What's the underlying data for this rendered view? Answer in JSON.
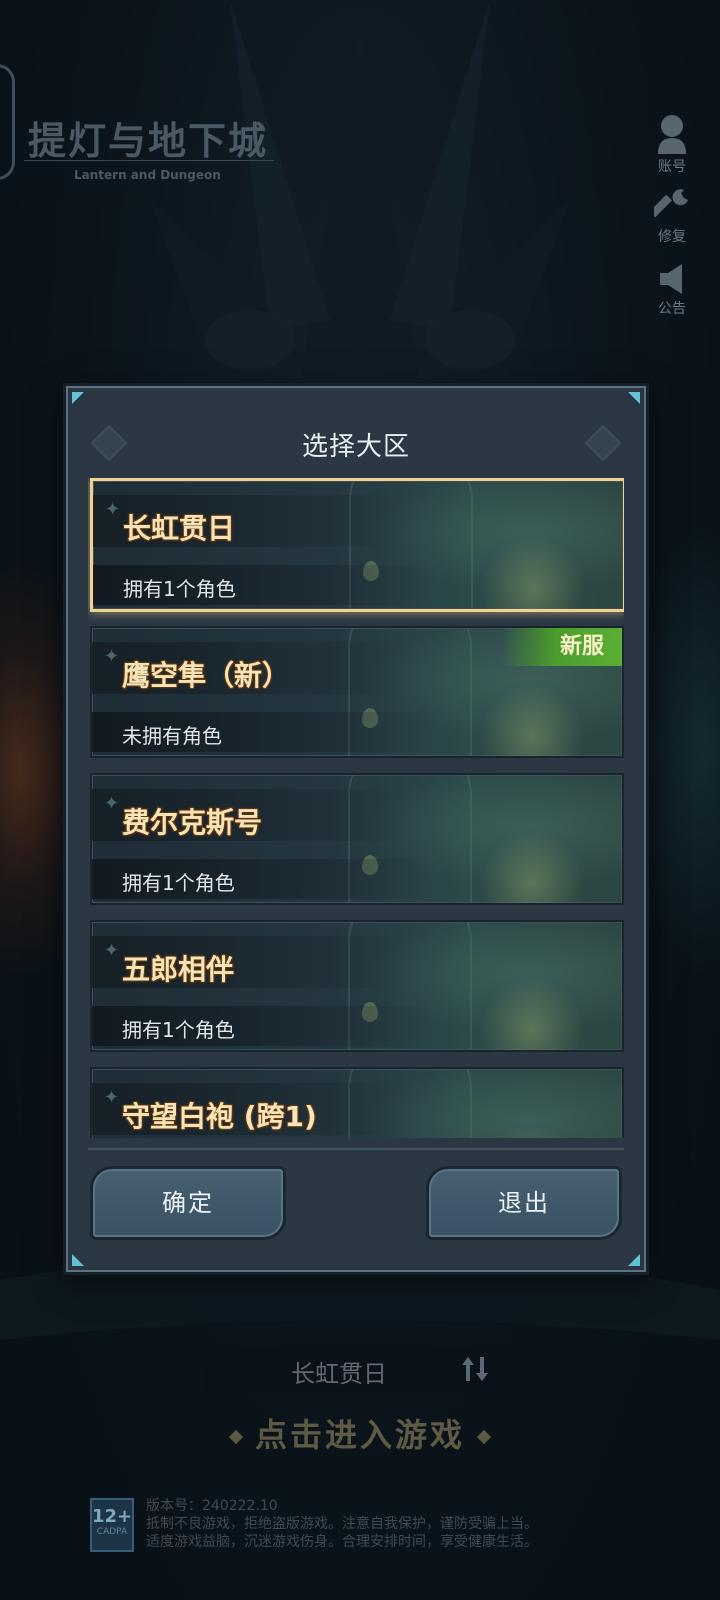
{
  "game": {
    "title": "提灯与地下城",
    "subtitle": "Lantern and Dungeon"
  },
  "side_menu": [
    {
      "label": "账号",
      "icon": "account-icon"
    },
    {
      "label": "修复",
      "icon": "wrench-icon"
    },
    {
      "label": "公告",
      "icon": "speaker-icon"
    }
  ],
  "dialog": {
    "title": "选择大区",
    "servers": [
      {
        "name": "长虹贯日",
        "status": "拥有1个角色",
        "selected": true,
        "badge": ""
      },
      {
        "name": "鹰空隼（新）",
        "status": "未拥有角色",
        "selected": false,
        "badge": "新服"
      },
      {
        "name": "费尔克斯号",
        "status": "拥有1个角色",
        "selected": false,
        "badge": ""
      },
      {
        "name": "五郎相伴",
        "status": "拥有1个角色",
        "selected": false,
        "badge": ""
      },
      {
        "name": "守望白袍 (跨1)",
        "status": "",
        "selected": false,
        "badge": ""
      }
    ],
    "confirm_label": "确定",
    "exit_label": "退出"
  },
  "bottom": {
    "current_server": "长虹贯日",
    "enter_game": "点击进入游戏",
    "age_rating": "12+",
    "age_org": "CADPA",
    "version": "版本号：240222.10",
    "notice_line1": "抵制不良游戏，拒绝盗版游戏。注意自我保护，谨防受骗上当。",
    "notice_line2": "适度游戏益脑，沉迷游戏伤身。合理安排时间，享受健康生活。"
  },
  "colors": {
    "selected_border": "#f1d18e",
    "new_badge": "#5aae34",
    "dialog_bg": "#2b3844",
    "accent_corner": "#62c2d6"
  }
}
